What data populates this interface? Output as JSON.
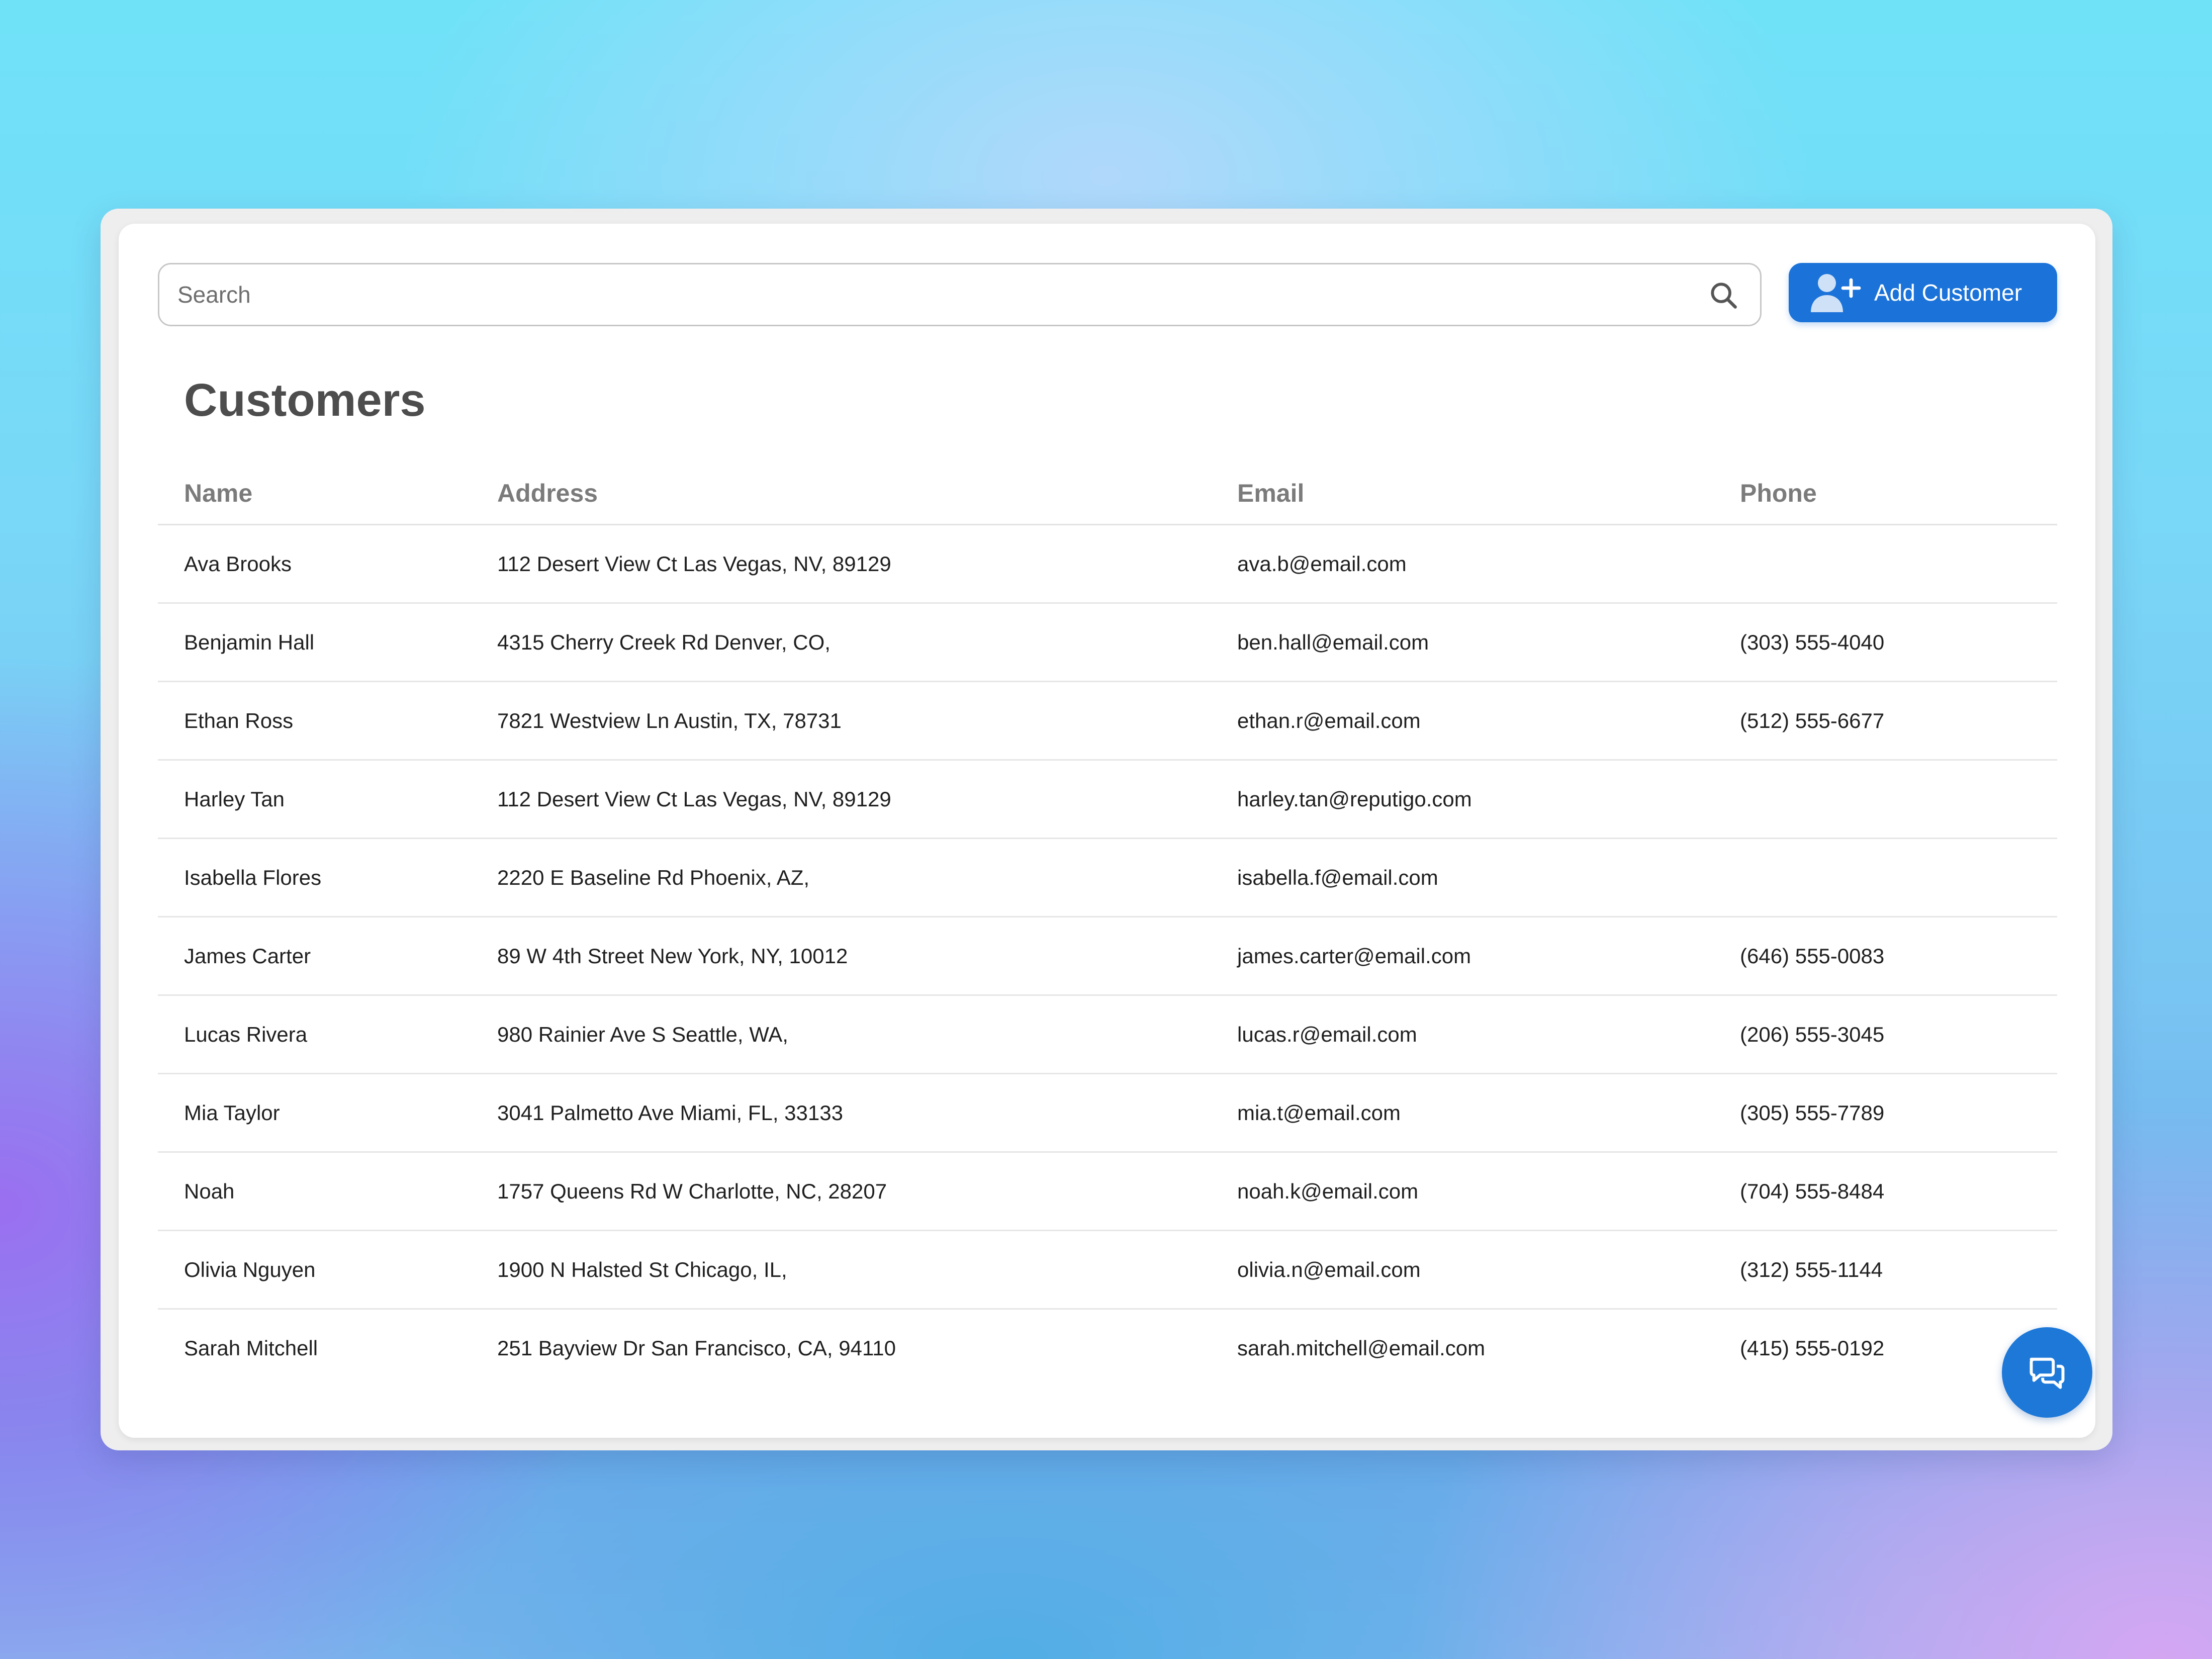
{
  "search": {
    "placeholder": "Search",
    "value": "",
    "icon": "search-icon"
  },
  "toolbar": {
    "add_customer_label": "Add Customer",
    "add_customer_icon": "add-user-icon"
  },
  "page": {
    "title": "Customers"
  },
  "table": {
    "columns": {
      "name": "Name",
      "address": "Address",
      "email": "Email",
      "phone": "Phone"
    },
    "rows": [
      {
        "name": "Ava Brooks",
        "address": "112 Desert View Ct Las Vegas, NV, 89129",
        "email": "ava.b@email.com",
        "phone": ""
      },
      {
        "name": "Benjamin Hall",
        "address": "4315 Cherry Creek Rd Denver, CO,",
        "email": "ben.hall@email.com",
        "phone": "(303) 555-4040"
      },
      {
        "name": "Ethan Ross",
        "address": "7821 Westview Ln Austin, TX, 78731",
        "email": "ethan.r@email.com",
        "phone": "(512) 555-6677"
      },
      {
        "name": "Harley Tan",
        "address": "112 Desert View Ct Las Vegas, NV, 89129",
        "email": "harley.tan@reputigo.com",
        "phone": ""
      },
      {
        "name": "Isabella Flores",
        "address": "2220 E Baseline Rd Phoenix, AZ,",
        "email": "isabella.f@email.com",
        "phone": ""
      },
      {
        "name": "James Carter",
        "address": "89 W 4th Street New York, NY, 10012",
        "email": "james.carter@email.com",
        "phone": "(646) 555-0083"
      },
      {
        "name": "Lucas Rivera",
        "address": "980 Rainier Ave S Seattle, WA,",
        "email": "lucas.r@email.com",
        "phone": "(206) 555-3045"
      },
      {
        "name": "Mia Taylor",
        "address": "3041 Palmetto Ave Miami, FL, 33133",
        "email": "mia.t@email.com",
        "phone": "(305) 555-7789"
      },
      {
        "name": "Noah",
        "address": "1757 Queens Rd W Charlotte, NC, 28207",
        "email": "noah.k@email.com",
        "phone": "(704) 555-8484"
      },
      {
        "name": "Olivia Nguyen",
        "address": "1900 N Halsted St Chicago, IL,",
        "email": "olivia.n@email.com",
        "phone": "(312) 555-1144"
      },
      {
        "name": "Sarah Mitchell",
        "address": "251 Bayview Dr San Francisco, CA, 94110",
        "email": "sarah.mitchell@email.com",
        "phone": "(415) 555-0192"
      }
    ]
  },
  "chat": {
    "icon": "chat-icon"
  },
  "colors": {
    "accent": "#1b73d9",
    "title": "#4d4d4d",
    "header_text": "#7b7b7b",
    "body_text": "#1f1f1f"
  }
}
